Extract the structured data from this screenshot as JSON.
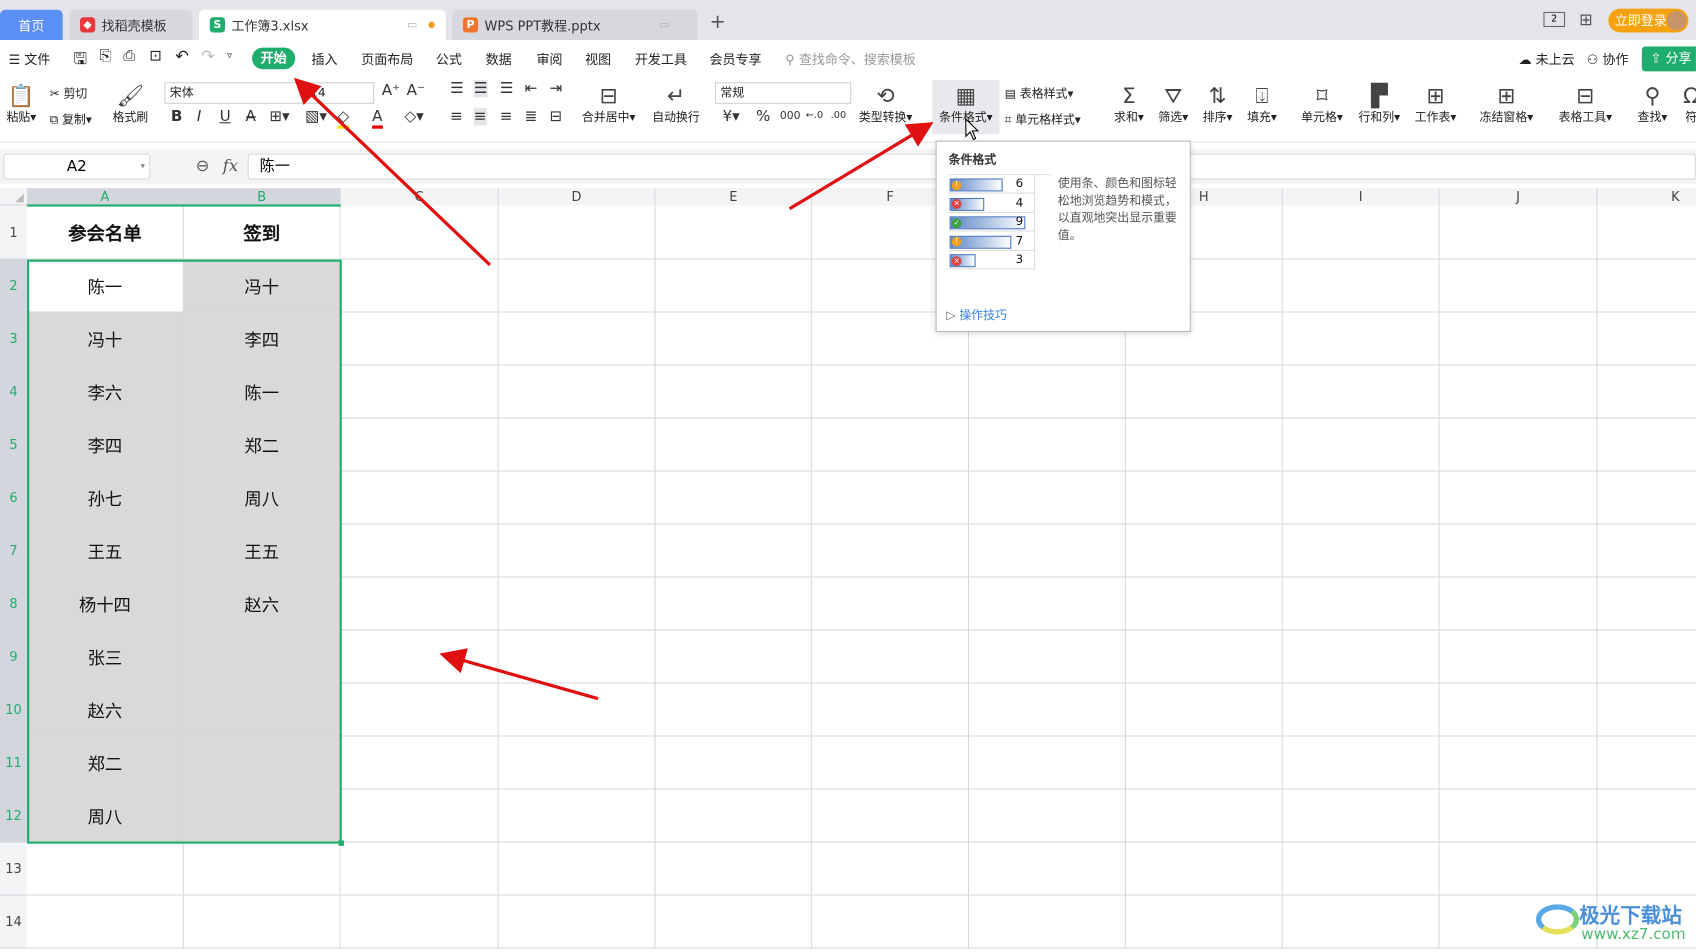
{
  "tabs": [
    {
      "label": "首页",
      "icon": "home"
    },
    {
      "label": "找稻壳模板",
      "icon": "docer-icon"
    },
    {
      "label": "工作簿3.xlsx",
      "icon": "spreadsheet-icon",
      "active": true
    },
    {
      "label": "WPS PPT教程.pptx",
      "icon": "presentation-icon"
    }
  ],
  "new_tab": "+",
  "login_label": "立即登录",
  "menu": {
    "file": "文件",
    "items": [
      "开始",
      "插入",
      "页面布局",
      "公式",
      "数据",
      "审阅",
      "视图",
      "开发工具",
      "会员专享"
    ],
    "search_placeholder": "查找命令、搜索模板",
    "cloud": "未上云",
    "collab": "协作",
    "share": "分享"
  },
  "ribbon": {
    "paste": "粘贴",
    "cut": "剪切",
    "copy": "复制",
    "format_painter": "格式刷",
    "font": "宋体",
    "font_size": "14",
    "number_format": "常规",
    "merge": "合并居中",
    "wrap": "自动换行",
    "convert": "类型转换",
    "cond_format": "条件格式",
    "table_style": "表格样式",
    "cell_style": "单元格样式",
    "sum": "求和",
    "filter": "筛选",
    "sort": "排序",
    "fill": "填充",
    "cell": "单元格",
    "rowcol": "行和列",
    "sheet": "工作表",
    "freeze": "冻结窗格",
    "table_tools": "表格工具",
    "find": "查找",
    "symbol": "符"
  },
  "formula_bar": {
    "name_box": "A2",
    "fx": "fx",
    "value": "陈一"
  },
  "columns": [
    "A",
    "B",
    "C",
    "D",
    "E",
    "F",
    "G",
    "H",
    "I",
    "J",
    "K"
  ],
  "rows": [
    "1",
    "2",
    "3",
    "4",
    "5",
    "6",
    "7",
    "8",
    "9",
    "10",
    "11",
    "12",
    "13",
    "14"
  ],
  "cells": {
    "A": [
      "参会名单",
      "陈一",
      "冯十",
      "李六",
      "李四",
      "孙七",
      "王五",
      "杨十四",
      "张三",
      "赵六",
      "郑二",
      "周八"
    ],
    "B": [
      "签到",
      "冯十",
      "李四",
      "陈一",
      "郑二",
      "周八",
      "王五",
      "赵六"
    ]
  },
  "selection": "A2:B12",
  "accent": "#1fad6d",
  "tooltip": {
    "title": "条件格式",
    "sample_values": [
      "6",
      "4",
      "9",
      "7",
      "3"
    ],
    "description": "使用条、颜色和图标轻松地浏览趋势和模式，以直观地突出显示重要值。",
    "link": "操作技巧"
  },
  "watermark": {
    "name": "极光下载站",
    "url": "www.xz7.com"
  }
}
